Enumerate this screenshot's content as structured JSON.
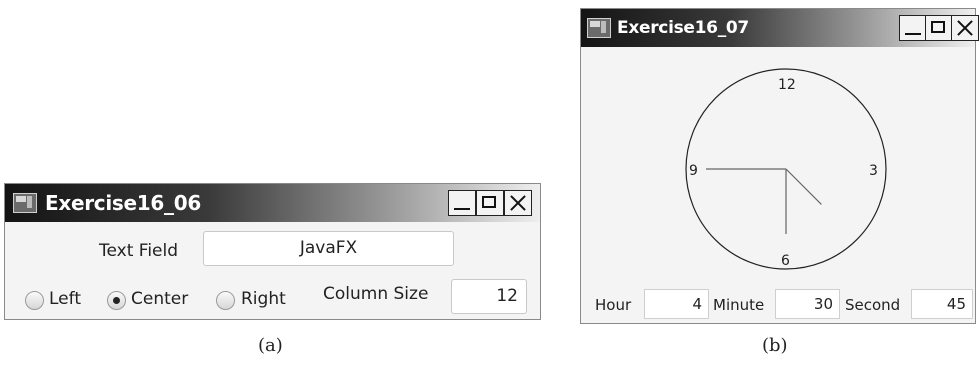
{
  "window_a": {
    "title": "Exercise16_06",
    "text_field_label": "Text Field",
    "text_field_value": "JavaFX",
    "radios": [
      {
        "label": "Left",
        "selected": false
      },
      {
        "label": "Center",
        "selected": true
      },
      {
        "label": "Right",
        "selected": false
      }
    ],
    "column_size_label": "Column Size",
    "column_size_value": "12",
    "caption": "(a)"
  },
  "window_b": {
    "title": "Exercise16_07",
    "clock": {
      "numbers": [
        "12",
        "3",
        "6",
        "9"
      ],
      "hour": 4,
      "minute": 30,
      "second": 45
    },
    "hour_label": "Hour",
    "hour_value": "4",
    "minute_label": "Minute",
    "minute_value": "30",
    "second_label": "Second",
    "second_value": "45",
    "caption": "(b)"
  },
  "colors": {
    "titlebar_dark": "#141414",
    "window_bg": "#f4f4f4"
  },
  "icons": [
    "app-icon",
    "minimize-icon",
    "maximize-icon",
    "close-icon",
    "radio-icon"
  ]
}
